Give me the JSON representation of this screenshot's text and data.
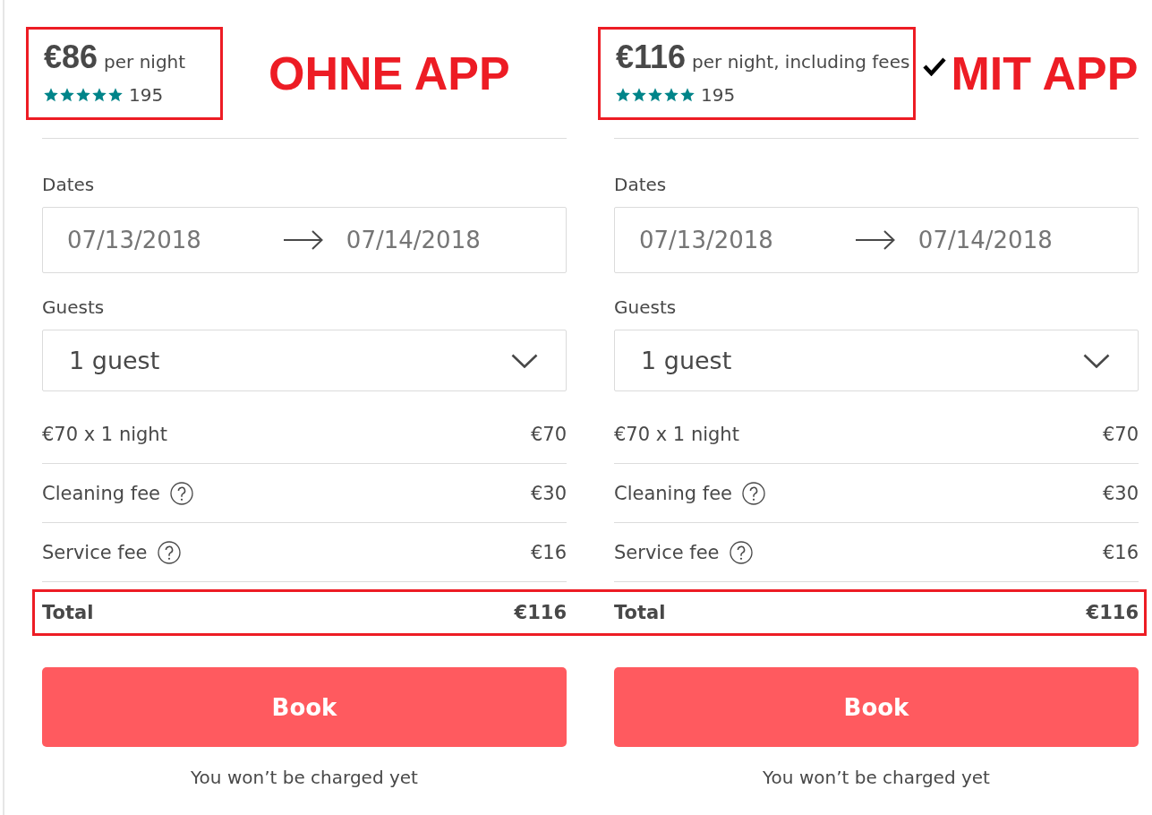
{
  "listings": [
    {
      "price": "€86",
      "price_unit": "per night",
      "stars": 5,
      "review_count": "195",
      "price_outlined": true,
      "annotation": {
        "label": "OHNE APP",
        "checked": false
      },
      "dates": {
        "label": "Dates",
        "check_in": "07/13/2018",
        "check_out": "07/14/2018"
      },
      "guests": {
        "label": "Guests",
        "value": "1 guest"
      },
      "line_items": [
        {
          "label": "€70 x 1 night",
          "amount": "€70",
          "info_icon": false
        },
        {
          "label": "Cleaning fee",
          "amount": "€30",
          "info_icon": true
        },
        {
          "label": "Service fee",
          "amount": "€16",
          "info_icon": true
        }
      ],
      "total": {
        "label": "Total",
        "amount": "€116"
      },
      "book_button": "Book",
      "note": "You won’t be charged yet"
    },
    {
      "price": "€116",
      "price_unit": "per night, including fees",
      "stars": 5,
      "review_count": "195",
      "price_outlined": true,
      "annotation": {
        "label": "MIT APP",
        "checked": true
      },
      "dates": {
        "label": "Dates",
        "check_in": "07/13/2018",
        "check_out": "07/14/2018"
      },
      "guests": {
        "label": "Guests",
        "value": "1 guest"
      },
      "line_items": [
        {
          "label": "€70 x 1 night",
          "amount": "€70",
          "info_icon": false
        },
        {
          "label": "Cleaning fee",
          "amount": "€30",
          "info_icon": true
        },
        {
          "label": "Service fee",
          "amount": "€16",
          "info_icon": true
        }
      ],
      "total": {
        "label": "Total",
        "amount": "€116"
      },
      "book_button": "Book",
      "note": "You won’t be charged yet"
    }
  ],
  "total_row_outlined": true
}
